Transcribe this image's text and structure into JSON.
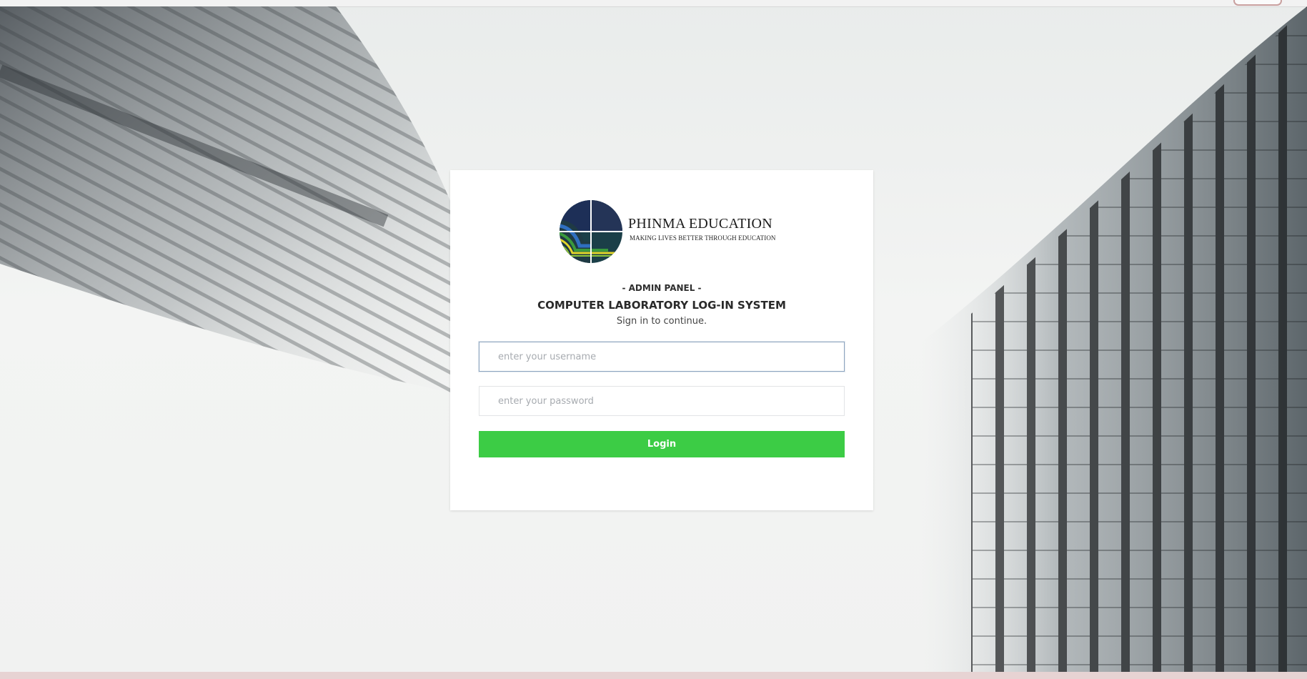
{
  "brand": {
    "name": "PHINMA EDUCATION",
    "tagline": "MAKING LIVES BETTER THROUGH EDUCATION"
  },
  "panel_label": "- ADMIN PANEL -",
  "system_title": "COMPUTER LABORATORY LOG-IN SYSTEM",
  "subtitle": "Sign in to continue.",
  "username": {
    "value": "",
    "placeholder": "enter your username"
  },
  "password": {
    "value": "",
    "placeholder": "enter your password"
  },
  "login_button": "Login",
  "colors": {
    "login_button": "#3ccc45",
    "card_background": "#ffffff",
    "username_focus_border": "#8ea6c0",
    "logo_navy": "#1d2f57",
    "logo_teal": "#1b3f48"
  }
}
